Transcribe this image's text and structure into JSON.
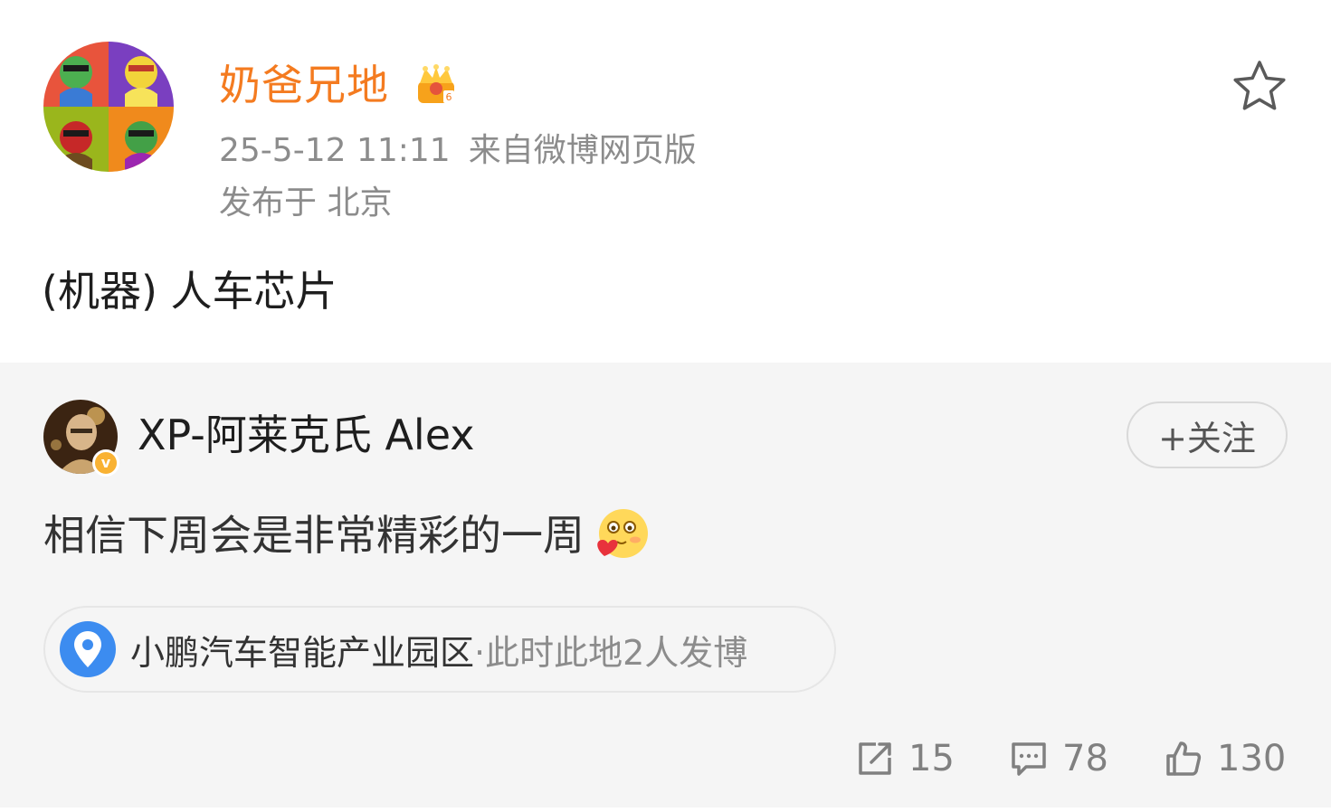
{
  "post": {
    "username": "奶爸兄地",
    "time": "25-5-12 11:11",
    "source": "来自微博网页版",
    "location": "发布于 北京",
    "text": "(机器) 人车芯片",
    "avatar_icon": "pop-art-avatar",
    "badge_icon": "crown-member-icon",
    "colors": {
      "username": "#f47b20",
      "meta": "#8c8c8c"
    }
  },
  "repost": {
    "username": "XP-阿莱克氏 Alex",
    "verified_badge": "v",
    "follow_label": "+关注",
    "text": "相信下周会是非常精彩的一周",
    "emoji_icon": "blush-heart-emoji",
    "poi": {
      "name": "小鹏汽车智能产业园区",
      "subtitle": "·此时此地2人发博",
      "icon": "location-pin-icon",
      "icon_color": "#3c8cf0"
    },
    "stats": {
      "shares": "15",
      "comments": "78",
      "likes": "130"
    }
  }
}
